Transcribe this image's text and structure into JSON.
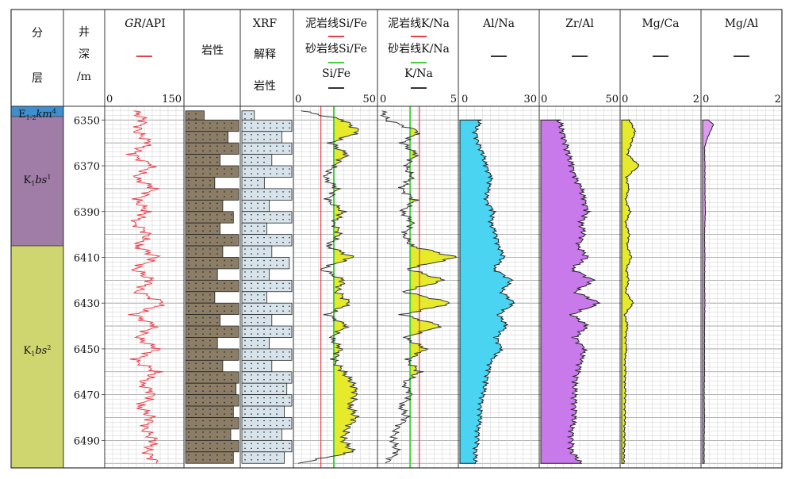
{
  "columns": {
    "layer": {
      "chars": [
        "分",
        "层"
      ]
    },
    "depth": {
      "chars": [
        "井",
        "深",
        "/m"
      ]
    },
    "gr": {
      "title_italic": "GR",
      "title_rest": "/API",
      "scale_min": "0",
      "scale_max": "150",
      "line_color": "#e8404a"
    },
    "lithology": {
      "title": "岩性"
    },
    "xrf": {
      "lines": [
        "XRF",
        "解释",
        "岩性"
      ]
    },
    "si_fe": {
      "labels": [
        "泥岩线Si/Fe",
        "砂岩线Si/Fe",
        "Si/Fe"
      ],
      "scale_min": "0",
      "scale_max": "50",
      "mudstone_color": "#e8404a",
      "sandstone_color": "#43d23a",
      "curve_color": "#333333",
      "fill_color": "#e6ea2a"
    },
    "k_na": {
      "labels": [
        "泥岩线K/Na",
        "砂岩线K/Na",
        "K/Na"
      ],
      "scale_min": "0",
      "scale_max": "5",
      "mudstone_color": "#e8404a",
      "sandstone_color": "#43d23a",
      "curve_color": "#333333",
      "fill_color": "#e6ea2a"
    },
    "al_na": {
      "title": "Al/Na",
      "scale_min": "0",
      "scale_max": "30",
      "fill_color": "#4ad4f2"
    },
    "zr_al": {
      "title": "Zr/Al",
      "scale_min": "0",
      "scale_max": "50",
      "fill_color": "#c879ea"
    },
    "mg_ca": {
      "title": "Mg/Ca",
      "scale_min": "0",
      "scale_max": "2",
      "fill_color": "#e6ea2a"
    },
    "mg_al": {
      "title": "Mg/Al",
      "scale_min": "0",
      "scale_max": "2",
      "fill_color": "#dd9aee"
    }
  },
  "zones": [
    {
      "main": "E",
      "sub": "1-2",
      "italic": "km",
      "sup": "4",
      "color": "#3d8fd0",
      "top_depth": 6344,
      "bottom_depth": 6348.5
    },
    {
      "main": "K",
      "sub": "1",
      "italic": "bs",
      "sup": "1",
      "color": "#a07da6",
      "top_depth": 6348.5,
      "bottom_depth": 6405
    },
    {
      "main": "K",
      "sub": "1",
      "italic": "bs",
      "sup": "2",
      "color": "#cfd56f",
      "top_depth": 6405,
      "bottom_depth": 6502
    }
  ],
  "chart_data": {
    "type": "line",
    "depth_range": [
      6344,
      6502
    ],
    "depth_ticks": [
      "6350",
      "6370",
      "6390",
      "6410",
      "6430",
      "6450",
      "6470",
      "6490"
    ],
    "tick_values": [
      6350,
      6370,
      6390,
      6410,
      6430,
      6450,
      6470,
      6490
    ],
    "gr": {
      "range": [
        0,
        150
      ],
      "depth": [
        6346,
        6350,
        6355,
        6360,
        6365,
        6370,
        6375,
        6380,
        6385,
        6390,
        6395,
        6400,
        6405,
        6410,
        6415,
        6420,
        6425,
        6430,
        6435,
        6440,
        6445,
        6450,
        6455,
        6460,
        6465,
        6470,
        6475,
        6480,
        6485,
        6490,
        6495,
        6500
      ],
      "values": [
        55,
        75,
        60,
        85,
        50,
        90,
        55,
        95,
        60,
        80,
        55,
        85,
        60,
        100,
        55,
        90,
        60,
        115,
        55,
        95,
        60,
        100,
        55,
        100,
        70,
        95,
        65,
        90,
        75,
        95,
        80,
        100
      ]
    },
    "lithology": {
      "depth": [
        6346,
        6350,
        6355,
        6360,
        6365,
        6370,
        6375,
        6380,
        6385,
        6390,
        6395,
        6400,
        6405,
        6410,
        6415,
        6420,
        6425,
        6430,
        6435,
        6440,
        6445,
        6450,
        6455,
        6460,
        6465,
        6470,
        6475,
        6480,
        6485,
        6490,
        6495,
        6500
      ],
      "width": [
        0.35,
        1,
        0.8,
        1,
        0.65,
        1,
        0.55,
        1,
        0.7,
        0.9,
        0.65,
        1,
        0.7,
        1,
        0.6,
        1,
        0.55,
        1,
        0.65,
        1,
        0.6,
        1,
        0.7,
        1,
        0.95,
        1,
        0.9,
        1,
        0.85,
        1,
        0.9,
        0.95
      ]
    },
    "xrf": {
      "depth": [
        6346,
        6350,
        6355,
        6360,
        6365,
        6370,
        6375,
        6380,
        6385,
        6390,
        6395,
        6400,
        6405,
        6410,
        6415,
        6420,
        6425,
        6430,
        6435,
        6440,
        6445,
        6450,
        6455,
        6460,
        6465,
        6470,
        6475,
        6480,
        6485,
        6490,
        6495,
        6500
      ],
      "width": [
        0.25,
        1,
        0.8,
        1,
        0.6,
        1,
        0.45,
        1,
        0.55,
        1,
        0.5,
        1,
        0.6,
        0.95,
        0.55,
        1,
        0.5,
        1,
        0.6,
        1,
        0.55,
        1,
        0.6,
        1,
        0.9,
        1,
        0.85,
        1,
        0.8,
        1,
        0.85,
        0.9
      ]
    },
    "si_fe": {
      "range": [
        0,
        50
      ],
      "mudstone_line": 16,
      "sandstone_line": 24,
      "depth": [
        6346,
        6350,
        6355,
        6360,
        6365,
        6370,
        6375,
        6380,
        6385,
        6390,
        6395,
        6400,
        6405,
        6410,
        6415,
        6420,
        6425,
        6430,
        6435,
        6440,
        6445,
        6450,
        6455,
        6460,
        6465,
        6470,
        6475,
        6480,
        6485,
        6490,
        6495,
        6500
      ],
      "values": [
        4,
        30,
        40,
        22,
        32,
        24,
        18,
        26,
        20,
        30,
        24,
        28,
        20,
        36,
        16,
        30,
        26,
        34,
        20,
        32,
        22,
        28,
        24,
        30,
        36,
        38,
        34,
        38,
        32,
        30,
        36,
        2
      ]
    },
    "k_na": {
      "range": [
        0,
        5
      ],
      "mudstone_line": 2.6,
      "sandstone_line": 2.0,
      "depth": [
        6346,
        6350,
        6355,
        6360,
        6365,
        6370,
        6375,
        6380,
        6385,
        6390,
        6395,
        6400,
        6405,
        6410,
        6415,
        6420,
        6425,
        6430,
        6435,
        6440,
        6445,
        6450,
        6455,
        6460,
        6465,
        6470,
        6475,
        6480,
        6485,
        6490,
        6495,
        6500
      ],
      "values": [
        0.2,
        0.5,
        2.6,
        1.5,
        2.4,
        1.7,
        2.1,
        1.4,
        2.3,
        1.5,
        2.2,
        1.6,
        2.1,
        5.0,
        1.8,
        4.2,
        1.6,
        4.7,
        1.5,
        4.0,
        1.6,
        3.0,
        1.8,
        2.6,
        1.6,
        2.1,
        1.4,
        1.8,
        1.1,
        0.9,
        1.2,
        0.4
      ]
    },
    "al_na": {
      "range": [
        0,
        30
      ],
      "depth": [
        6350,
        6355,
        6360,
        6365,
        6370,
        6375,
        6380,
        6385,
        6390,
        6395,
        6400,
        6405,
        6410,
        6415,
        6420,
        6425,
        6430,
        6435,
        6440,
        6445,
        6450,
        6455,
        6460,
        6465,
        6470,
        6475,
        6480,
        6485,
        6490,
        6495,
        6500
      ],
      "values": [
        8,
        6,
        7,
        9,
        10,
        12,
        11,
        10,
        13,
        12,
        14,
        15,
        17,
        13,
        20,
        16,
        21,
        15,
        18,
        14,
        16,
        12,
        11,
        10,
        9,
        8,
        8,
        7,
        7,
        6,
        6
      ]
    },
    "zr_al": {
      "range": [
        0,
        50
      ],
      "depth": [
        6350,
        6355,
        6360,
        6365,
        6370,
        6375,
        6380,
        6385,
        6390,
        6395,
        6400,
        6405,
        6410,
        6415,
        6420,
        6425,
        6430,
        6435,
        6440,
        6445,
        6450,
        6455,
        6460,
        6465,
        6470,
        6475,
        6480,
        6485,
        6490,
        6495,
        6500
      ],
      "values": [
        12,
        14,
        16,
        18,
        20,
        22,
        26,
        28,
        30,
        26,
        28,
        24,
        30,
        20,
        34,
        22,
        38,
        20,
        30,
        22,
        28,
        26,
        24,
        22,
        22,
        22,
        22,
        20,
        20,
        20,
        26
      ]
    },
    "mg_ca": {
      "range": [
        0,
        2
      ],
      "depth": [
        6350,
        6355,
        6360,
        6365,
        6370,
        6375,
        6380,
        6385,
        6390,
        6395,
        6400,
        6405,
        6410,
        6415,
        6420,
        6425,
        6430,
        6435,
        6440,
        6445,
        6450,
        6455,
        6460,
        6465,
        6470,
        6475,
        6480,
        6485,
        6490,
        6495,
        6500
      ],
      "values": [
        0.2,
        0.35,
        0.25,
        0.15,
        0.45,
        0.12,
        0.18,
        0.1,
        0.22,
        0.1,
        0.2,
        0.14,
        0.25,
        0.12,
        0.18,
        0.1,
        0.3,
        0.08,
        0.15,
        0.1,
        0.12,
        0.08,
        0.1,
        0.08,
        0.1,
        0.08,
        0.09,
        0.07,
        0.08,
        0.06,
        0.06
      ]
    },
    "mg_al": {
      "range": [
        0,
        2
      ],
      "depth": [
        6350,
        6352,
        6355,
        6358,
        6362,
        6370,
        6380,
        6390,
        6400,
        6410,
        6420,
        6430,
        6440,
        6450,
        6460,
        6470,
        6480,
        6490,
        6500
      ],
      "values": [
        0.15,
        0.28,
        0.2,
        0.12,
        0.05,
        0.06,
        0.06,
        0.07,
        0.05,
        0.06,
        0.05,
        0.06,
        0.05,
        0.05,
        0.05,
        0.04,
        0.05,
        0.04,
        0.04
      ]
    }
  }
}
